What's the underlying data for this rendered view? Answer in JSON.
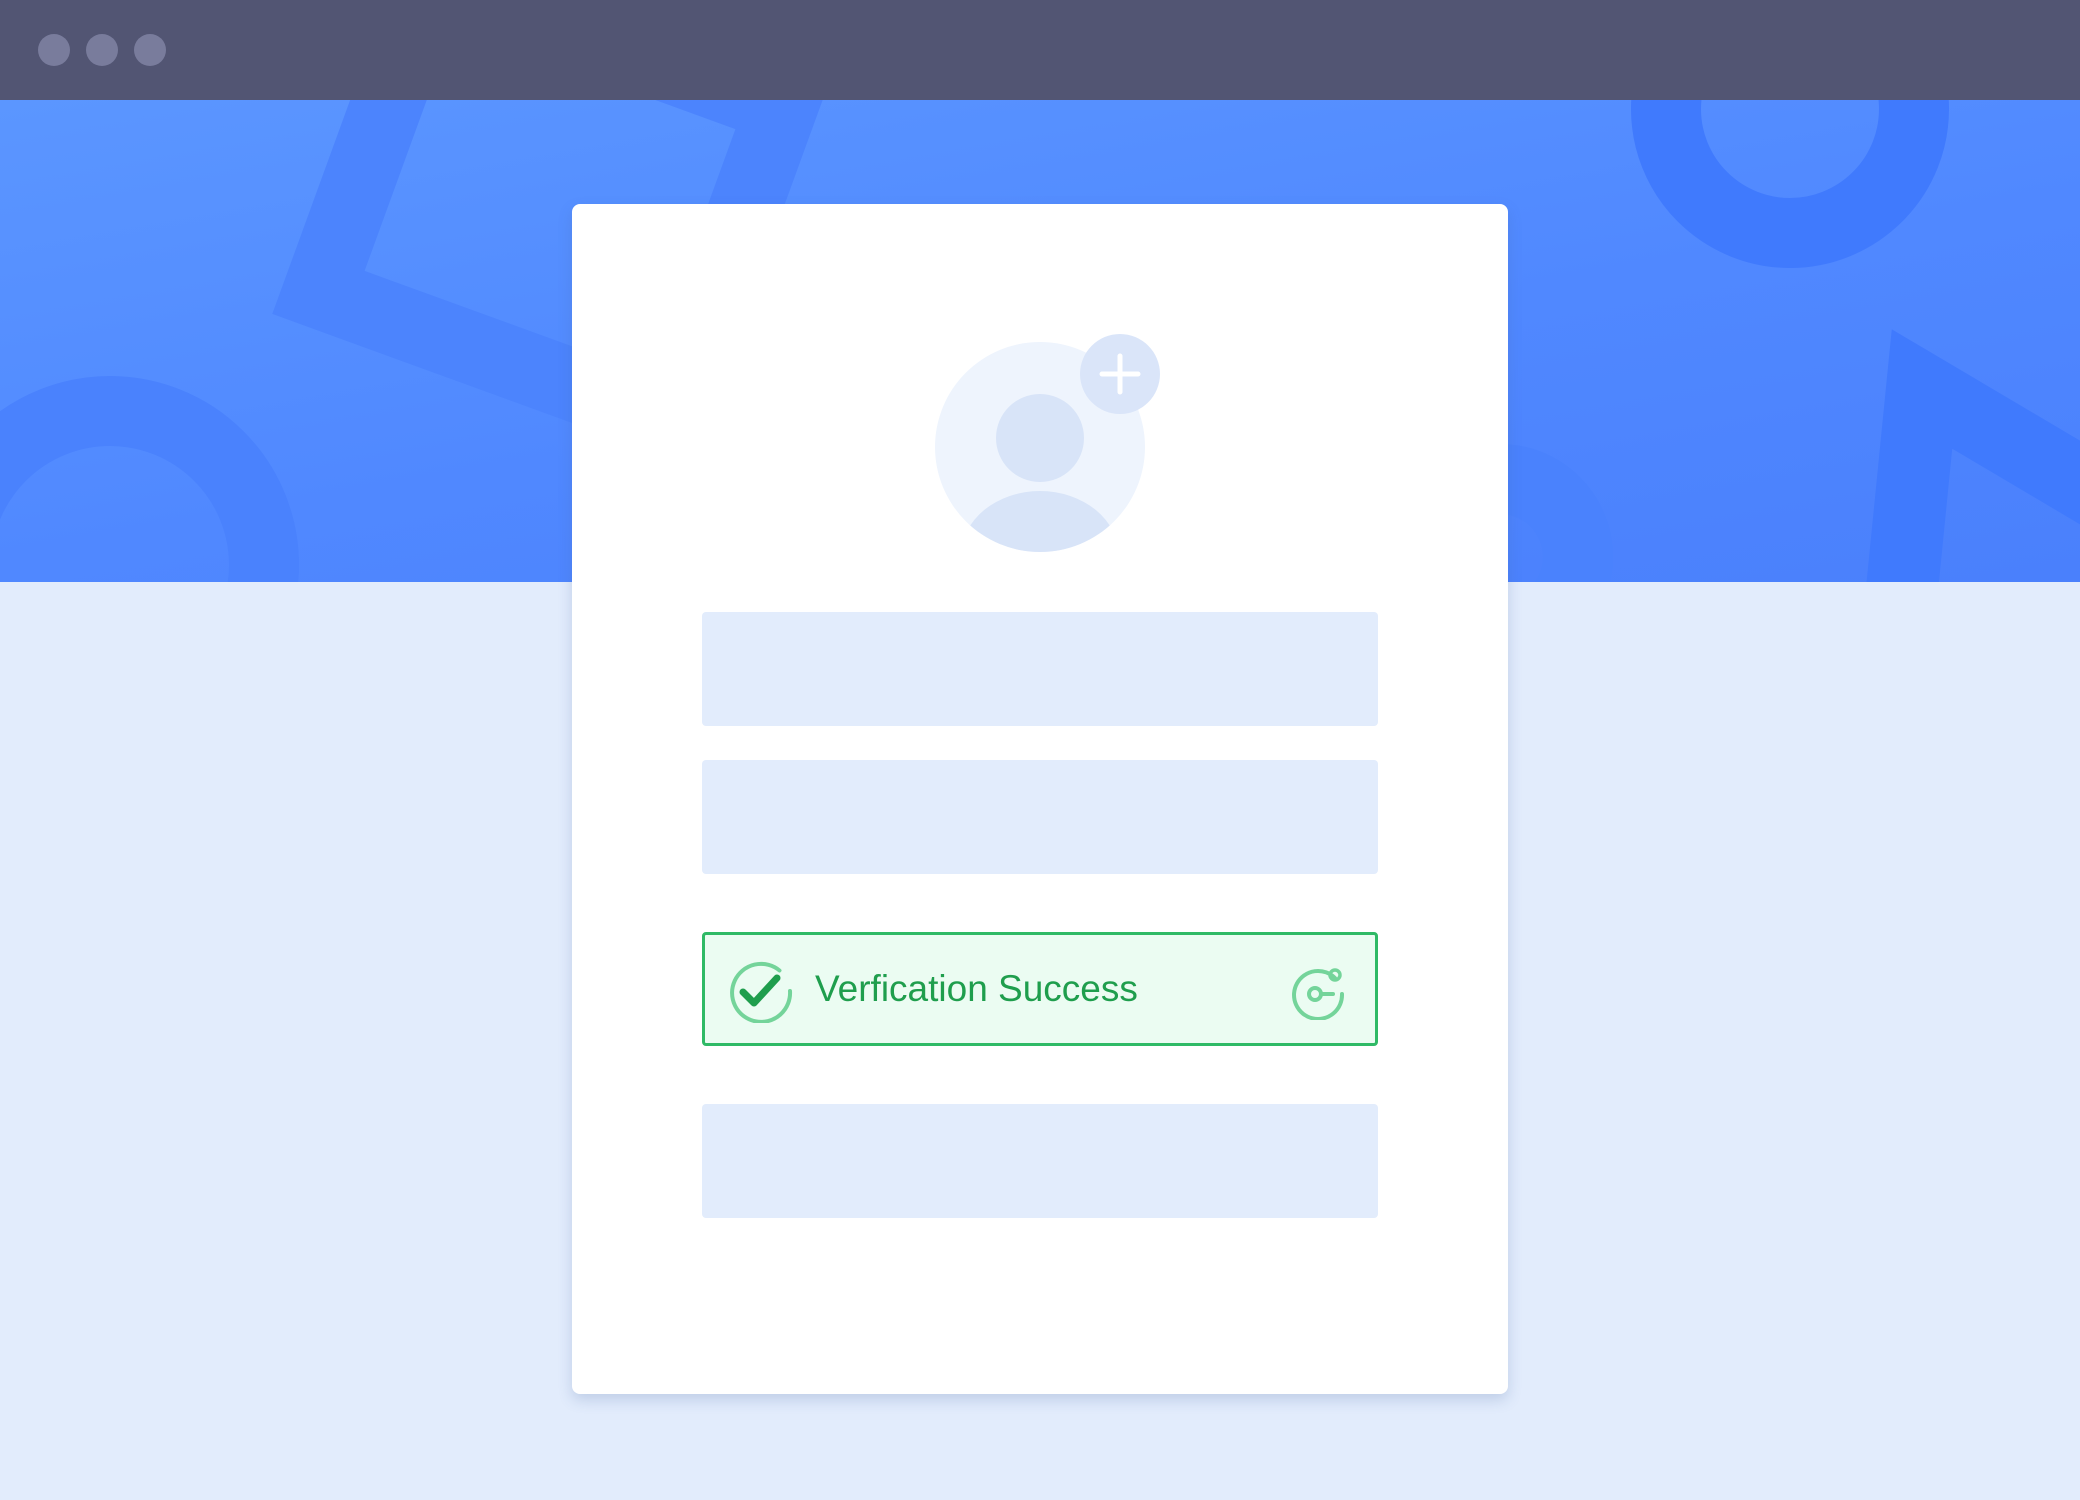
{
  "window": {
    "controls": [
      "window-dot",
      "window-dot",
      "window-dot"
    ]
  },
  "profile": {
    "avatar_icon": "user-avatar-icon",
    "add_photo_icon": "plus-icon"
  },
  "form": {
    "fields": [
      {
        "name": "field-1",
        "value": ""
      },
      {
        "name": "field-2",
        "value": ""
      },
      {
        "name": "field-3",
        "value": ""
      }
    ],
    "verification": {
      "status_text": "Verfication Success",
      "status_icon": "check-circle-icon",
      "brand_icon": "captcha-logo-icon",
      "success_color": "#2fba66",
      "text_color": "#1f9e4d",
      "background_color": "#ebfcf2"
    }
  },
  "colors": {
    "titlebar": "#525573",
    "hero": "#5088ff",
    "page_background": "#e2ecfc",
    "card": "#ffffff"
  }
}
